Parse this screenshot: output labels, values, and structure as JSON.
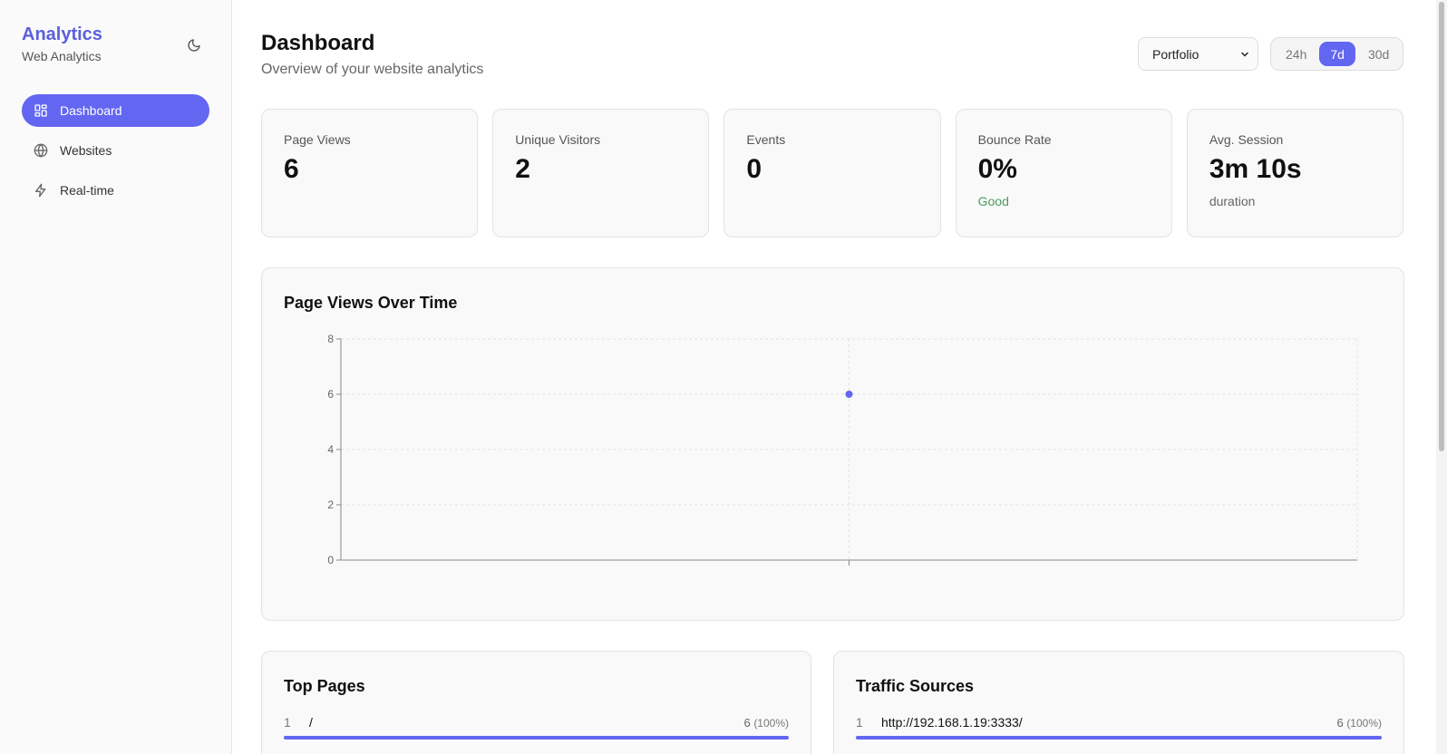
{
  "sidebar": {
    "brand_title": "Analytics",
    "brand_subtitle": "Web Analytics",
    "theme_toggle_icon": "moon-icon",
    "items": [
      {
        "label": "Dashboard",
        "icon": "dashboard-icon",
        "active": true
      },
      {
        "label": "Websites",
        "icon": "globe-icon",
        "active": false
      },
      {
        "label": "Real-time",
        "icon": "lightning-icon",
        "active": false
      }
    ]
  },
  "header": {
    "title": "Dashboard",
    "subtitle": "Overview of your website analytics",
    "site_select": {
      "value": "Portfolio"
    },
    "ranges": [
      {
        "label": "24h",
        "active": false
      },
      {
        "label": "7d",
        "active": true
      },
      {
        "label": "30d",
        "active": false
      }
    ]
  },
  "stats": [
    {
      "label": "Page Views",
      "value": "6",
      "note": ""
    },
    {
      "label": "Unique Visitors",
      "value": "2",
      "note": ""
    },
    {
      "label": "Events",
      "value": "0",
      "note": ""
    },
    {
      "label": "Bounce Rate",
      "value": "0%",
      "note": "Good"
    },
    {
      "label": "Avg. Session",
      "value": "3m 10s",
      "note": "duration"
    }
  ],
  "chart_card": {
    "title": "Page Views Over Time"
  },
  "chart_data": {
    "type": "line",
    "title": "Page Views Over Time",
    "xlabel": "",
    "ylabel": "",
    "x": [
      ""
    ],
    "series": [
      {
        "values": [
          6
        ]
      }
    ],
    "ylim": [
      0,
      8
    ],
    "yticks": [
      0,
      2,
      4,
      6,
      8
    ],
    "grid": true,
    "legend": "none"
  },
  "top_pages": {
    "title": "Top Pages",
    "rows": [
      {
        "rank": "1",
        "label": "/",
        "count": "6",
        "pct": "(100%)",
        "fraction": 1.0
      }
    ]
  },
  "traffic_sources": {
    "title": "Traffic Sources",
    "rows": [
      {
        "rank": "1",
        "label": "http://192.168.1.19:3333/",
        "count": "6",
        "pct": "(100%)",
        "fraction": 1.0
      }
    ]
  },
  "colors": {
    "accent": "#6366f1",
    "brand": "#5b5fdc",
    "good": "#4a9a63"
  }
}
